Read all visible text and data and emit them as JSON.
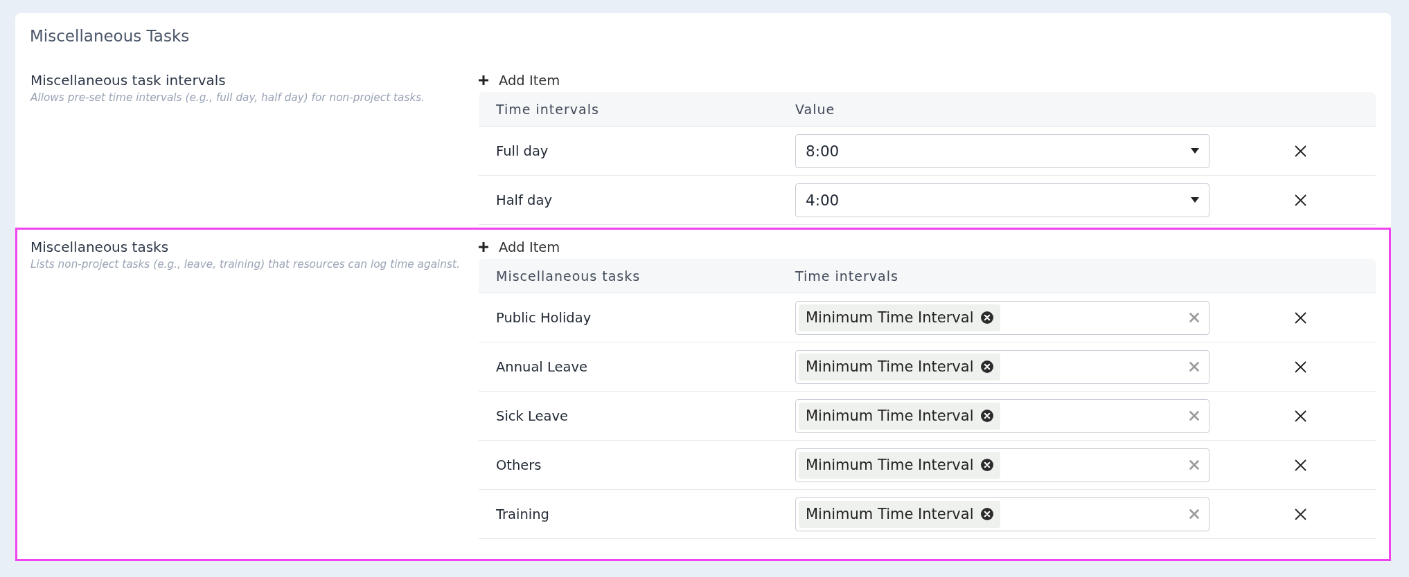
{
  "card": {
    "title": "Miscellaneous Tasks"
  },
  "sections": [
    {
      "title": "Miscellaneous task intervals",
      "description": "Allows pre-set time intervals (e.g., full day, half day) for non-project tasks.",
      "highlighted": false,
      "add_label": "Add Item",
      "columns": [
        "Time intervals",
        "Value"
      ],
      "rows": [
        {
          "label": "Full day",
          "kind": "select",
          "value": "8:00"
        },
        {
          "label": "Half day",
          "kind": "select",
          "value": "4:00"
        }
      ]
    },
    {
      "title": "Miscellaneous tasks",
      "description": "Lists non-project tasks (e.g., leave, training) that resources can log time against.",
      "highlighted": true,
      "add_label": "Add Item",
      "columns": [
        "Miscellaneous tasks",
        "Time intervals"
      ],
      "rows": [
        {
          "label": "Public Holiday",
          "kind": "tags",
          "tags": [
            "Minimum Time Interval"
          ]
        },
        {
          "label": "Annual Leave",
          "kind": "tags",
          "tags": [
            "Minimum Time Interval"
          ]
        },
        {
          "label": "Sick Leave",
          "kind": "tags",
          "tags": [
            "Minimum Time Interval"
          ]
        },
        {
          "label": "Others",
          "kind": "tags",
          "tags": [
            "Minimum Time Interval"
          ]
        },
        {
          "label": "Training",
          "kind": "tags",
          "tags": [
            "Minimum Time Interval"
          ]
        }
      ]
    }
  ]
}
